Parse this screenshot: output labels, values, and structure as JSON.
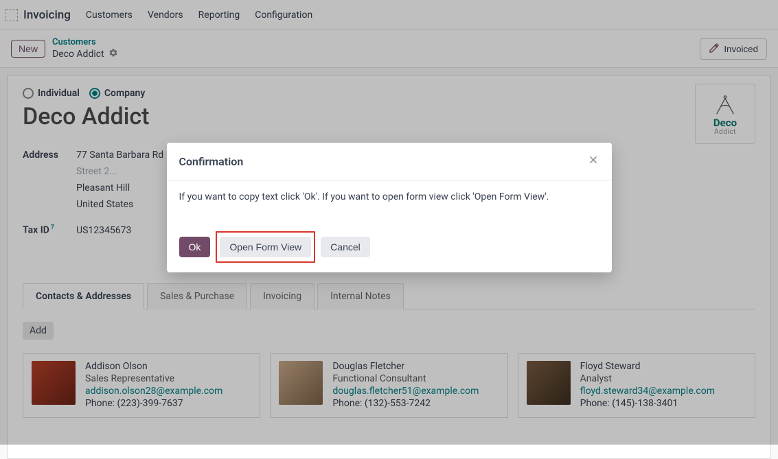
{
  "nav": {
    "app_name": "Invoicing",
    "links": [
      "Customers",
      "Vendors",
      "Reporting",
      "Configuration"
    ]
  },
  "action_bar": {
    "new_label": "New",
    "breadcrumb_parent": "Customers",
    "breadcrumb_current": "Deco Addict",
    "invoiced_label": "Invoiced"
  },
  "form": {
    "radio_individual": "Individual",
    "radio_company": "Company",
    "company_name": "Deco Addict",
    "logo_text": "Deco",
    "logo_sub": "Addict",
    "address_label": "Address",
    "address": {
      "line1": "77 Santa Barbara Rd",
      "line2_placeholder": "Street 2...",
      "city": "Pleasant Hill",
      "country": "United States"
    },
    "taxid_label": "Tax ID",
    "taxid_q": "?",
    "taxid_value": "US12345673"
  },
  "tabs": [
    "Contacts & Addresses",
    "Sales & Purchase",
    "Invoicing",
    "Internal Notes"
  ],
  "add_label": "Add",
  "contacts": [
    {
      "name": "Addison Olson",
      "role": "Sales Representative",
      "email": "addison.olson28@example.com",
      "phone": "Phone: (223)-399-7637"
    },
    {
      "name": "Douglas Fletcher",
      "role": "Functional Consultant",
      "email": "douglas.fletcher51@example.com",
      "phone": "Phone: (132)-553-7242"
    },
    {
      "name": "Floyd Steward",
      "role": "Analyst",
      "email": "floyd.steward34@example.com",
      "phone": "Phone: (145)-138-3401"
    }
  ],
  "modal": {
    "title": "Confirmation",
    "body": "If you want to copy text click 'Ok'. If you want to open form view click 'Open Form View'.",
    "ok_label": "Ok",
    "open_form_label": "Open Form View",
    "cancel_label": "Cancel"
  },
  "colors": {
    "primary": "#714B67",
    "teal": "#017e84",
    "highlight": "#d9362b"
  }
}
